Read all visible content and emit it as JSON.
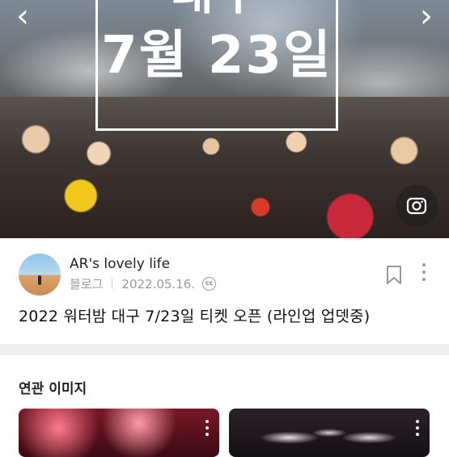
{
  "hero": {
    "title_line1": "대구",
    "title_line2": "7월 23일",
    "prev_icon": "chevron-left-icon",
    "next_icon": "chevron-right-icon",
    "lens_icon": "image-search-icon"
  },
  "post": {
    "blog_name": "AR's lovely life",
    "source": "블로그",
    "date": "2022.05.16.",
    "license_badge": "cc",
    "title": "2022 워터밤 대구 7/23일 티켓 오픈 (라인업 업뎃중)"
  },
  "related": {
    "title": "연관 이미지",
    "thumbnails": [
      {
        "name": "related-thumb-1"
      },
      {
        "name": "related-thumb-2"
      }
    ]
  },
  "colors": {
    "accent_text": "#222222",
    "muted_text": "#9a9a9a",
    "divider": "#eeeeee"
  }
}
